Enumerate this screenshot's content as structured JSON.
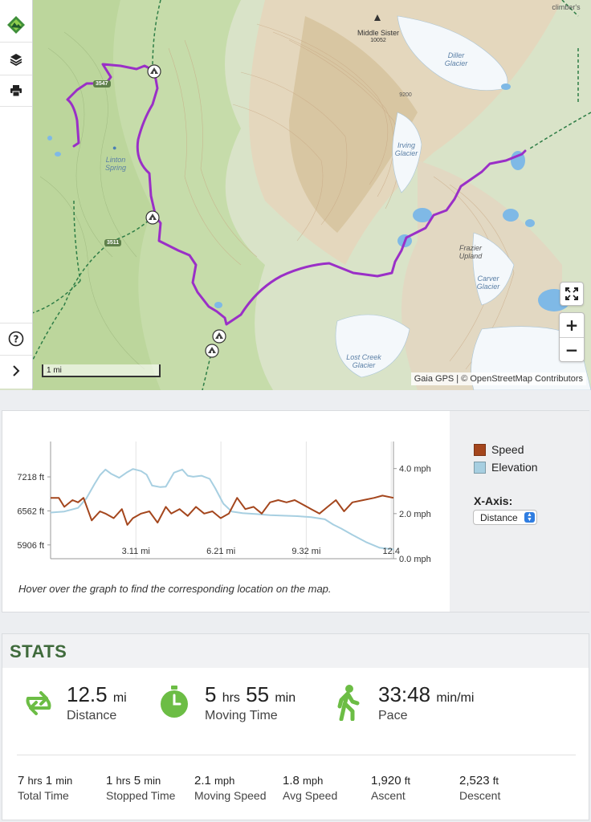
{
  "map": {
    "attribution": "Gaia GPS | © OpenStreetMap Contributors",
    "scale_label": "1 mi",
    "labels": {
      "middle_sister": "Middle Sister",
      "middle_sister_elev": "10052",
      "diller_glacier": "Diller\nGlacier",
      "irving_glacier": "Irving\nGlacier",
      "linton_spring": "Linton\nSpring",
      "frazier_upland": "Frazier\nUpland",
      "carver_glacier": "Carver\nGlacier",
      "lost_creek_glacier": "Lost Creek\nGlacier",
      "climbers": "climber's",
      "contour": "9200"
    },
    "road_shields": [
      "3547",
      "3511"
    ],
    "route_color": "#9a2fc7",
    "toolbar": [
      "gaia-logo-icon",
      "layers-icon",
      "print-icon",
      "help-icon",
      "chevron-right-icon"
    ],
    "controls": {
      "zoom_in": "+",
      "zoom_out": "−"
    }
  },
  "graph": {
    "legend": [
      {
        "name": "Speed",
        "color": "#a4461d"
      },
      {
        "name": "Elevation",
        "color": "#a7cfe1"
      }
    ],
    "xaxis_title": "X-Axis:",
    "xaxis_selected": "Distance",
    "hint": "Hover over the graph to find the corresponding location on the map."
  },
  "chart_data": {
    "type": "line",
    "xlabel": "",
    "ylabel": "",
    "x_ticks": [
      "3.11 mi",
      "6.21 mi",
      "9.32 mi",
      "12.4"
    ],
    "x_tick_values": [
      3.11,
      6.21,
      9.32,
      12.42
    ],
    "xlim": [
      0,
      12.5
    ],
    "y_left_ticks": [
      "7218 ft",
      "6562 ft",
      "5906 ft"
    ],
    "y_left_tick_values": [
      7218,
      6562,
      5906
    ],
    "ylim_left": [
      5640,
      7900
    ],
    "y_right_ticks": [
      "4.0 mph",
      "2.0 mph",
      "0.0 mph"
    ],
    "y_right_tick_values": [
      4.0,
      2.0,
      0.0
    ],
    "ylim_right": [
      0,
      5.2
    ],
    "grid": true,
    "series": [
      {
        "name": "Elevation",
        "axis": "left",
        "color": "#a7cfe1",
        "x": [
          0,
          0.5,
          1.0,
          1.3,
          1.6,
          1.8,
          2.0,
          2.2,
          2.5,
          2.8,
          3.0,
          3.3,
          3.5,
          3.7,
          4.0,
          4.2,
          4.5,
          4.8,
          5.0,
          5.2,
          5.5,
          5.8,
          6.0,
          6.3,
          6.6,
          7.0,
          7.5,
          8.0,
          8.5,
          9.0,
          9.5,
          10.0,
          10.3,
          10.6,
          11.0,
          11.5,
          12.0,
          12.5
        ],
        "y": [
          6530,
          6550,
          6620,
          6800,
          7080,
          7250,
          7360,
          7280,
          7200,
          7310,
          7370,
          7330,
          7260,
          7050,
          7020,
          7030,
          7300,
          7360,
          7240,
          7220,
          7240,
          7180,
          7000,
          6700,
          6550,
          6520,
          6500,
          6480,
          6470,
          6460,
          6440,
          6400,
          6300,
          6220,
          6100,
          5960,
          5850,
          5820
        ]
      },
      {
        "name": "Speed",
        "axis": "right",
        "color": "#a4461d",
        "x": [
          0,
          0.3,
          0.5,
          0.8,
          1.0,
          1.2,
          1.5,
          1.8,
          2.0,
          2.3,
          2.6,
          2.8,
          3.0,
          3.3,
          3.6,
          3.9,
          4.2,
          4.4,
          4.7,
          5.0,
          5.3,
          5.6,
          5.9,
          6.2,
          6.5,
          6.8,
          7.1,
          7.4,
          7.7,
          8.0,
          8.3,
          8.6,
          8.9,
          9.2,
          9.5,
          9.8,
          10.1,
          10.4,
          10.7,
          11.0,
          11.4,
          11.8,
          12.1,
          12.5
        ],
        "y": [
          2.7,
          2.7,
          2.3,
          2.6,
          2.5,
          2.7,
          1.7,
          2.1,
          2.0,
          1.8,
          2.2,
          1.5,
          1.8,
          2.0,
          2.1,
          1.6,
          2.3,
          2.0,
          2.2,
          1.9,
          2.3,
          2.0,
          2.1,
          1.8,
          2.0,
          2.7,
          2.2,
          2.3,
          2.0,
          2.5,
          2.6,
          2.5,
          2.6,
          2.4,
          2.2,
          2.0,
          2.3,
          2.6,
          2.1,
          2.5,
          2.6,
          2.7,
          2.8,
          2.7
        ]
      }
    ]
  },
  "stats": {
    "title": "STATS",
    "distance": {
      "value": "12.5",
      "unit": "mi",
      "label": "Distance"
    },
    "moving_time": {
      "h": "5",
      "h_unit": "hrs",
      "m": "55",
      "m_unit": "min",
      "label": "Moving Time"
    },
    "pace": {
      "value": "33:48",
      "unit": "min/mi",
      "label": "Pace"
    },
    "total_time": {
      "h": "7",
      "h_unit": "hrs",
      "m": "1",
      "m_unit": "min",
      "label": "Total Time"
    },
    "stopped_time": {
      "h": "1",
      "h_unit": "hrs",
      "m": "5",
      "m_unit": "min",
      "label": "Stopped Time"
    },
    "moving_speed": {
      "value": "2.1",
      "unit": "mph",
      "label": "Moving Speed"
    },
    "avg_speed": {
      "value": "1.8",
      "unit": "mph",
      "label": "Avg Speed"
    },
    "ascent": {
      "value": "1,920",
      "unit": "ft",
      "label": "Ascent"
    },
    "descent": {
      "value": "2,523",
      "unit": "ft",
      "label": "Descent"
    },
    "icon_color": "#6cbd45"
  }
}
